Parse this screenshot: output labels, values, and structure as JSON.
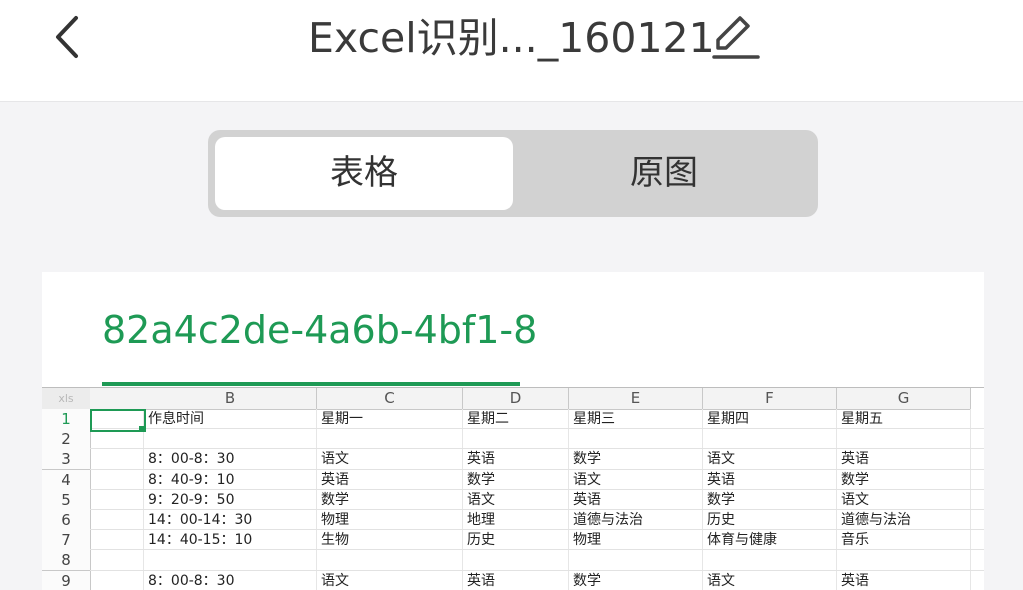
{
  "header": {
    "title": "Excel识别..._160121",
    "back_icon": "chevron-left-icon",
    "edit_icon": "pencil-icon"
  },
  "segmented": {
    "tabs": [
      {
        "label": "表格",
        "selected": true
      },
      {
        "label": "原图",
        "selected": false
      }
    ]
  },
  "sheet": {
    "name": "82a4c2de-4a6b-4bf1-8",
    "corner_label": "xls",
    "columns": [
      "B",
      "C",
      "D",
      "E",
      "F",
      "G"
    ],
    "row_numbers": [
      "1",
      "2",
      "3",
      "4",
      "5",
      "6",
      "7",
      "8",
      "9"
    ],
    "selected_cell": "A1",
    "rows": [
      [
        "作息时间",
        "星期一",
        "星期二",
        "星期三",
        "星期四",
        "星期五"
      ],
      [
        "",
        "",
        "",
        "",
        "",
        ""
      ],
      [
        "8：00-8：30",
        "语文",
        "英语",
        "数学",
        "语文",
        "英语"
      ],
      [
        "8：40-9：10",
        "英语",
        "数学",
        "语文",
        "英语",
        "数学"
      ],
      [
        "9：20-9：50",
        "数学",
        "语文",
        "英语",
        "数学",
        "语文"
      ],
      [
        "14：00-14：30",
        "物理",
        "地理",
        "道德与法治",
        "历史",
        "道德与法治"
      ],
      [
        "14：40-15：10",
        "生物",
        "历史",
        "物理",
        "体育与健康",
        "音乐"
      ],
      [
        "",
        "",
        "",
        "",
        "",
        ""
      ],
      [
        "8：00-8：30",
        "语文",
        "英语",
        "数学",
        "语文",
        "英语"
      ]
    ]
  },
  "colors": {
    "accent": "#1e9a55",
    "segment_bg": "#d2d2d2",
    "page_bg": "#f4f4f6"
  }
}
